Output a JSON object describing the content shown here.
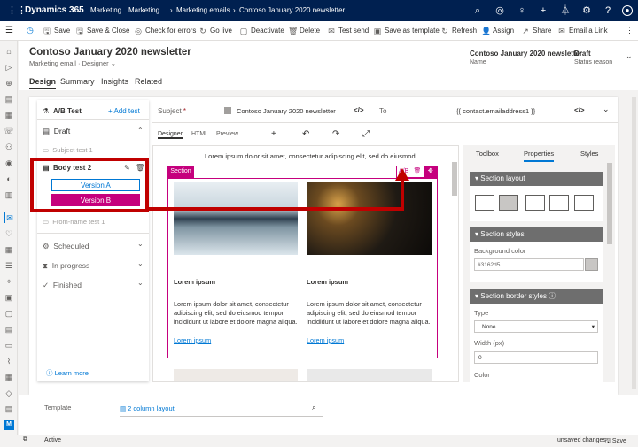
{
  "topbar": {
    "app": "Dynamics 365",
    "area": "Marketing",
    "crumbs": [
      "Marketing",
      "Marketing emails",
      "Contoso January 2020 newsletter"
    ],
    "icons": [
      "search-icon",
      "lightbulb-icon",
      "help-icon",
      "add-icon",
      "filter-icon",
      "gear-icon",
      "question-icon",
      "user-icon"
    ]
  },
  "commands": [
    {
      "icon": "save-icon",
      "glyph": "🖫",
      "label": "Save"
    },
    {
      "icon": "save-close-icon",
      "glyph": "🖫",
      "label": "Save & Close"
    },
    {
      "icon": "check-icon",
      "glyph": "◎",
      "label": "Check for errors"
    },
    {
      "icon": "golive-icon",
      "glyph": "↻",
      "label": "Go live"
    },
    {
      "icon": "deactivate-icon",
      "glyph": "▢",
      "label": "Deactivate"
    },
    {
      "icon": "delete-icon",
      "glyph": "🗑",
      "label": "Delete"
    },
    {
      "icon": "test-send-icon",
      "glyph": "✉",
      "label": "Test send"
    },
    {
      "icon": "template-icon",
      "glyph": "▣",
      "label": "Save as template"
    },
    {
      "icon": "refresh-icon",
      "glyph": "↻",
      "label": "Refresh"
    },
    {
      "icon": "assign-icon",
      "glyph": "👤",
      "label": "Assign"
    },
    {
      "icon": "share-icon",
      "glyph": "↗",
      "label": "Share"
    },
    {
      "icon": "email-link-icon",
      "glyph": "✉",
      "label": "Email a Link"
    }
  ],
  "record": {
    "title": "Contoso January 2020 newsletter",
    "subtitle": "Marketing email",
    "form": "Designer",
    "name_value": "Contoso January 2020 newsletter",
    "name_label": "Name",
    "status_value": "Draft",
    "status_label": "Status reason"
  },
  "tabs": [
    "Design",
    "Summary",
    "Insights",
    "Related"
  ],
  "abtest": {
    "title": "A/B Test",
    "add": "Add test",
    "draft": "Draft",
    "subject_test": "Subject test 1",
    "body_test": "Body test 2",
    "version_a": "Version A",
    "version_b": "Version B",
    "from_test": "From-name test 1",
    "scheduled": "Scheduled",
    "in_progress": "In progress",
    "finished": "Finished",
    "learn_more": "Learn more"
  },
  "subject": {
    "label": "Subject",
    "required": "*",
    "value": "Contoso January 2020 newsletter",
    "to_label": "To",
    "to_value": "{{ contact.emailaddress1 }}"
  },
  "editor": {
    "views": [
      "Designer",
      "HTML",
      "Preview"
    ],
    "preheader": "Lorem ipsum dolor sit amet, consectetur adipiscing elit, sed do eiusmod",
    "section_label": "Section",
    "ab_label": "A/B",
    "col_heading": "Lorem ipsum",
    "col_body": "Lorem ipsum dolor sit amet, consectetur adipiscing elit, sed do eiusmod tempor incididunt ut labore et dolore magna aliqua.",
    "col_link": "Lorem ipsum"
  },
  "rpanel": {
    "tabs": [
      "Toolbox",
      "Properties",
      "Styles"
    ],
    "layout_header": "Section layout",
    "styles_header": "Section styles",
    "bg_label": "Background color",
    "bg_value": "#3162d5",
    "border_header": "Section border styles",
    "type_label": "Type",
    "type_value": "None",
    "width_label": "Width (px)",
    "width_value": "0",
    "color_label": "Color"
  },
  "footer": {
    "template_label": "Template",
    "template_value": "2 column layout"
  },
  "status": {
    "left": "Active",
    "unsaved": "unsaved changes",
    "save": "Save"
  },
  "colors": {
    "accent": "#0078d4",
    "highlight": "#c5007d",
    "red": "#c00000",
    "nav": "#002050"
  }
}
